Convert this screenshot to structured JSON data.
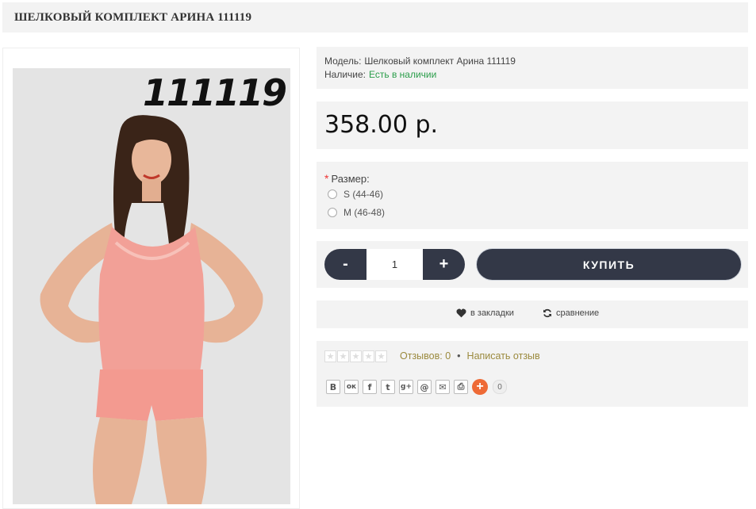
{
  "product": {
    "title": "ШЕЛКОВЫЙ КОМПЛЕКТ АРИНА 111119",
    "image_number": "111119",
    "model_label": "Модель:",
    "model_value": "Шелковый комплект Арина 111119",
    "stock_label": "Наличие:",
    "stock_value": "Есть в наличии",
    "price": "358.00 р."
  },
  "options": {
    "required_mark": "*",
    "label": "Размер:",
    "choices": [
      "S (44-46)",
      "M (46-48)"
    ]
  },
  "cart": {
    "minus": "-",
    "quantity": "1",
    "plus": "+",
    "buy_label": "КУПИТЬ"
  },
  "actions": {
    "wishlist": "в закладки",
    "compare": "сравнение"
  },
  "reviews": {
    "rating_stars": 0,
    "count_text": "Отзывов: 0",
    "separator": "•",
    "write_text": "Написать отзыв"
  },
  "share": {
    "buttons": [
      "В",
      "ок",
      "f",
      "t",
      "g+",
      "@",
      "✉",
      "⎙"
    ],
    "plus": "+",
    "count": "0"
  },
  "colors": {
    "dark_button": "#333847",
    "in_stock": "#2a9d4a",
    "panel_bg": "#f3f3f3",
    "share_plus": "#ee6a36"
  }
}
